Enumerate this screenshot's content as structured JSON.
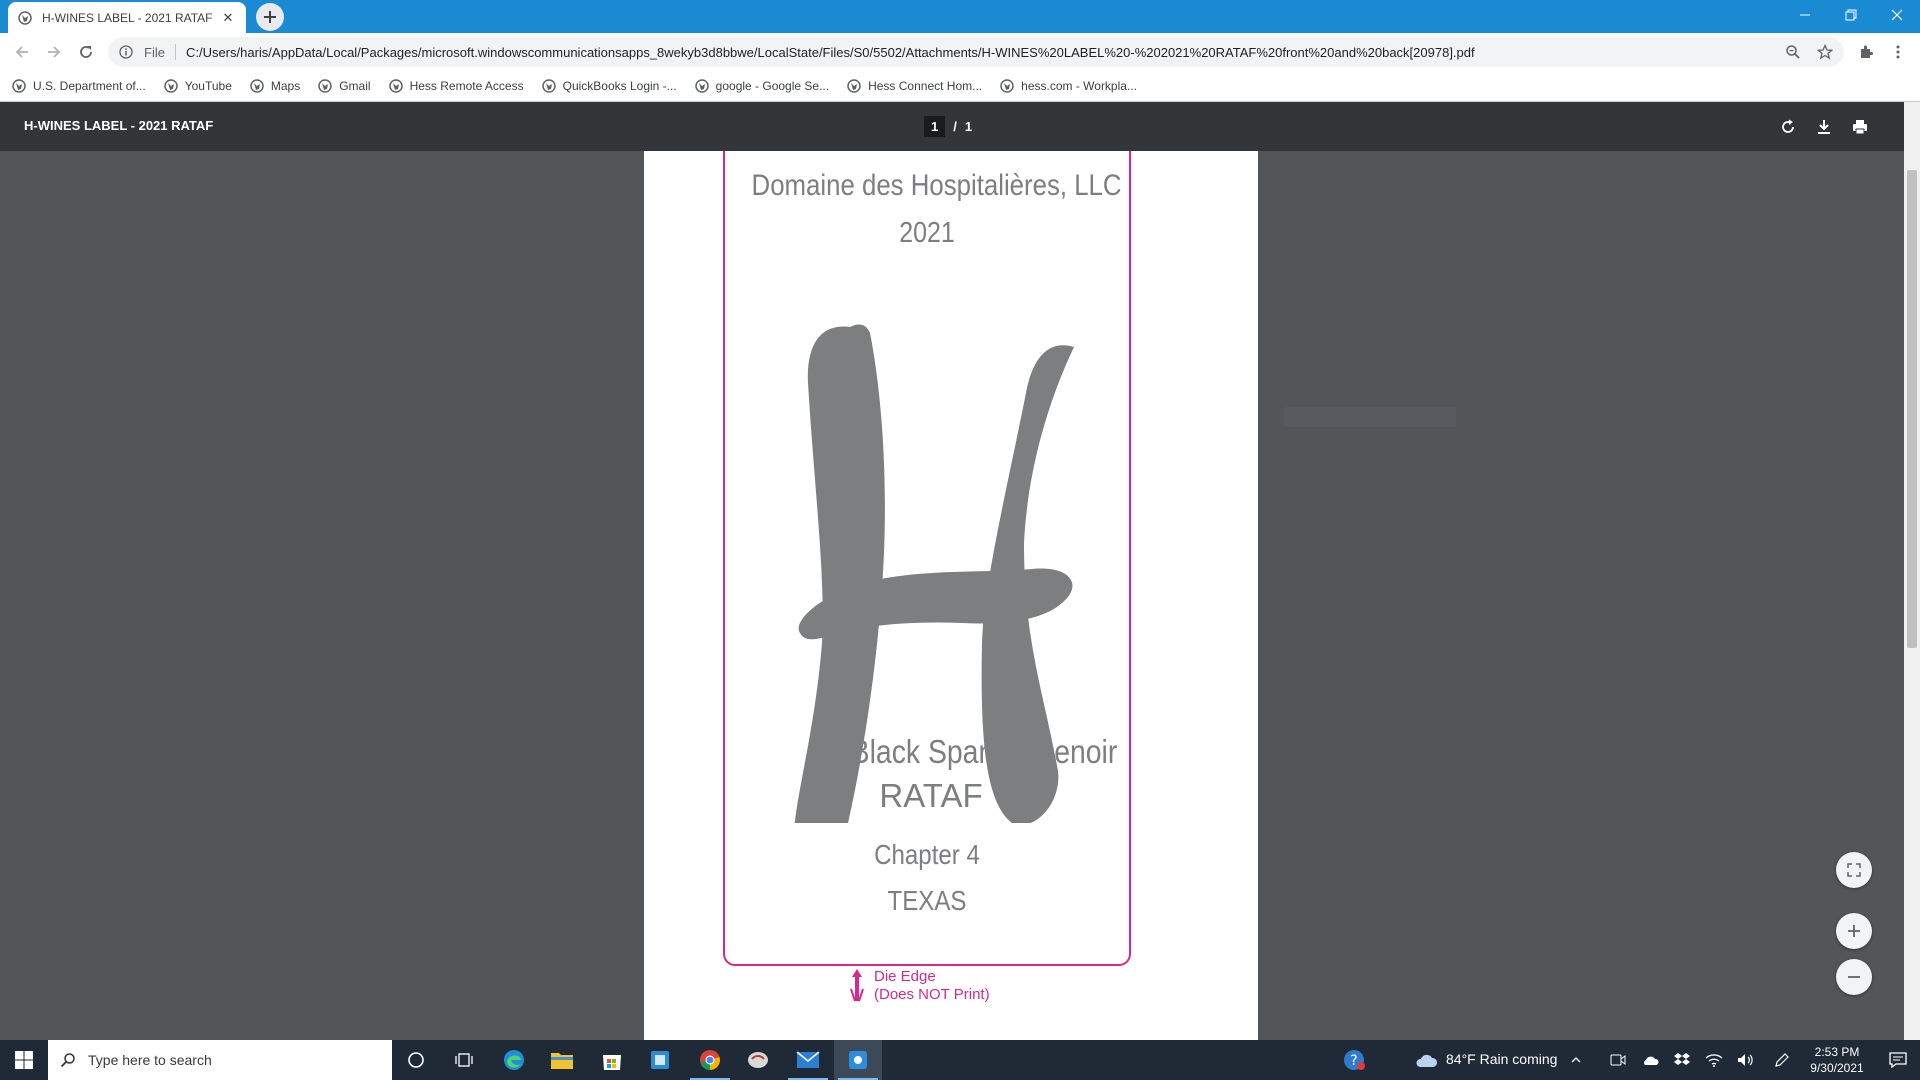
{
  "browser": {
    "tab_title": "H-WINES LABEL - 2021 RATAF front and back[20978].pdf",
    "address_scheme": "File",
    "address_url": "C:/Users/haris/AppData/Local/Packages/microsoft.windowscommunicationsapps_8wekyb3d8bbwe/LocalState/Files/S0/5502/Attachments/H-WINES%20LABEL%20-%202021%20RATAF%20front%20and%20back[20978].pdf",
    "bookmarks": [
      "U.S. Department of...",
      "YouTube",
      "Maps",
      "Gmail",
      "Hess Remote Access",
      "QuickBooks Login -...",
      "google - Google Se...",
      "Hess Connect Hom...",
      "hess.com - Workpla..."
    ]
  },
  "pdf": {
    "title": "H-WINES LABEL - 2021 RATAF",
    "current_page": "1",
    "page_separator": "/",
    "total_pages": "1"
  },
  "wine_label": {
    "winery": "Domaine des Hospitalières, LLC",
    "vintage": "2021",
    "variety": "Black Spanish Lenoir",
    "style": "RATAF",
    "chapter": "Chapter 4",
    "state": "TEXAS",
    "die_edge_line1": "Die Edge",
    "die_edge_line2": "(Does NOT Print)",
    "text_color": "#7d7e80",
    "die_color": "#d8288e"
  },
  "taskbar": {
    "search_placeholder": "Type here to search",
    "weather": "84°F  Rain coming",
    "time": "2:53 PM",
    "date": "9/30/2021"
  },
  "colors": {
    "chrome_blue": "#1a8bd3",
    "pdf_toolbar": "#323639",
    "pdf_background": "#525659",
    "taskbar": "#1f2a36"
  }
}
